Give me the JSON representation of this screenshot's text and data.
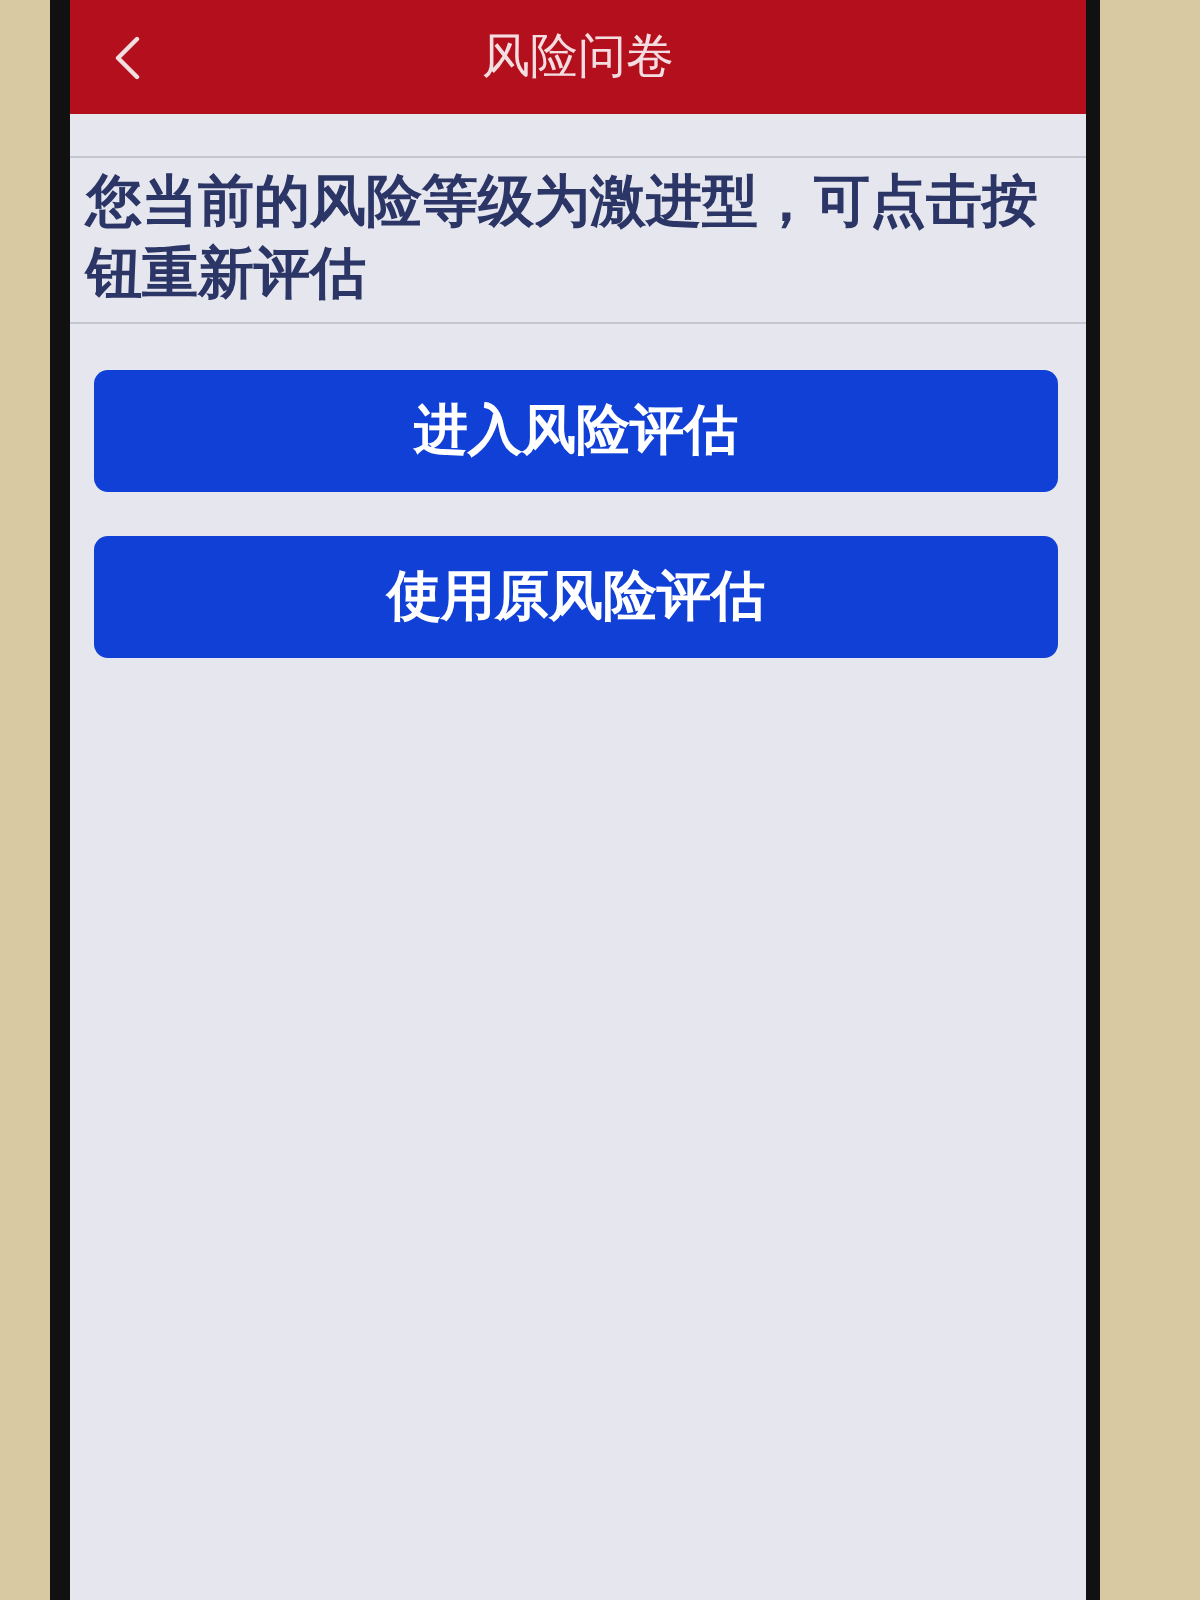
{
  "header": {
    "title": "风险问卷"
  },
  "message": "您当前的风险等级为激进型，可点击按钮重新评估",
  "buttons": [
    {
      "label": "进入风险评估"
    },
    {
      "label": "使用原风险评估"
    }
  ]
}
